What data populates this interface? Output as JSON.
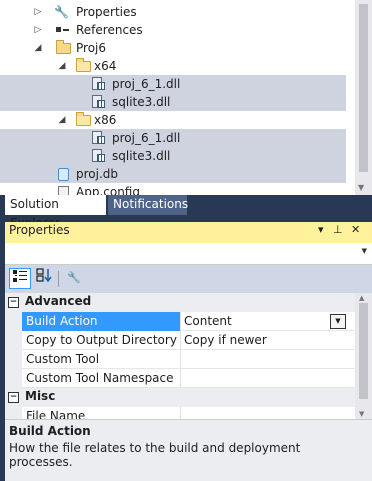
{
  "solution_explorer": {
    "tree": [
      {
        "label": "Properties",
        "icon": "wrench-icon",
        "expander": "collapsed"
      },
      {
        "label": "References",
        "icon": "references-icon",
        "expander": "collapsed"
      },
      {
        "label": "Proj6",
        "icon": "folder-icon",
        "expander": "expanded"
      },
      {
        "label": "x64",
        "icon": "folder-open-icon",
        "expander": "expanded"
      },
      {
        "label": "proj_6_1.dll",
        "icon": "dll-icon"
      },
      {
        "label": "sqlite3.dll",
        "icon": "dll-icon"
      },
      {
        "label": "x86",
        "icon": "folder-open-icon",
        "expander": "expanded"
      },
      {
        "label": "proj_6_1.dll",
        "icon": "dll-icon"
      },
      {
        "label": "sqlite3.dll",
        "icon": "dll-icon"
      },
      {
        "label": "proj.db",
        "icon": "database-file-icon"
      },
      {
        "label": "App.config",
        "icon": "config-file-icon"
      }
    ]
  },
  "tabs": {
    "solution_explorer": "Solution Explorer",
    "notifications": "Notifications"
  },
  "properties": {
    "title": "Properties",
    "title_buttons": {
      "dropdown": "▾",
      "pin": "⊥",
      "close": "✕"
    },
    "categories": {
      "advanced": "Advanced",
      "misc": "Misc"
    },
    "rows": [
      {
        "name": "Build Action",
        "value": "Content"
      },
      {
        "name": "Copy to Output Directory",
        "value": "Copy if newer"
      },
      {
        "name": "Custom Tool",
        "value": ""
      },
      {
        "name": "Custom Tool Namespace",
        "value": ""
      },
      {
        "name": "File Name",
        "value": ""
      }
    ],
    "description": {
      "heading": "Build Action",
      "text": "How the file relates to the build and deployment processes."
    }
  },
  "colors": {
    "accent": "#3399ff",
    "title_bar": "#fff29d",
    "chrome": "#293955",
    "selection": "#cfd3df"
  }
}
